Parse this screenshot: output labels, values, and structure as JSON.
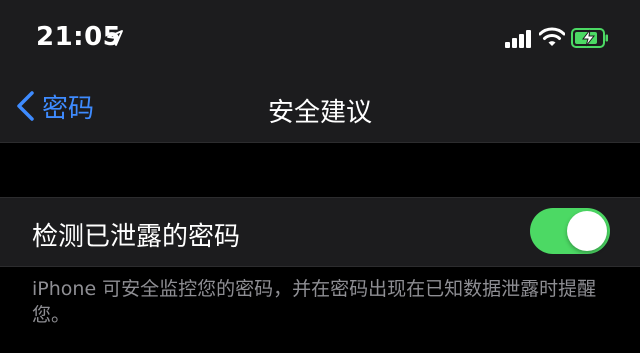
{
  "status_bar": {
    "time": "21:05",
    "icons": [
      "location-icon",
      "signal-icon",
      "wifi-icon",
      "battery-charging-icon"
    ]
  },
  "nav": {
    "back_label": "密码",
    "title": "安全建议"
  },
  "settings": {
    "detect_leaked_label": "检测已泄露的密码",
    "detect_leaked_enabled": true,
    "footer": "iPhone 可安全监控您的密码，并在密码出现在已知数据泄露时提醒您。"
  },
  "colors": {
    "accent": "#3e8bff",
    "toggle_on": "#4cd964",
    "battery": "#4cd964",
    "background": "#000000",
    "cell": "#1c1c1e",
    "secondary_text": "#8e8e93"
  }
}
